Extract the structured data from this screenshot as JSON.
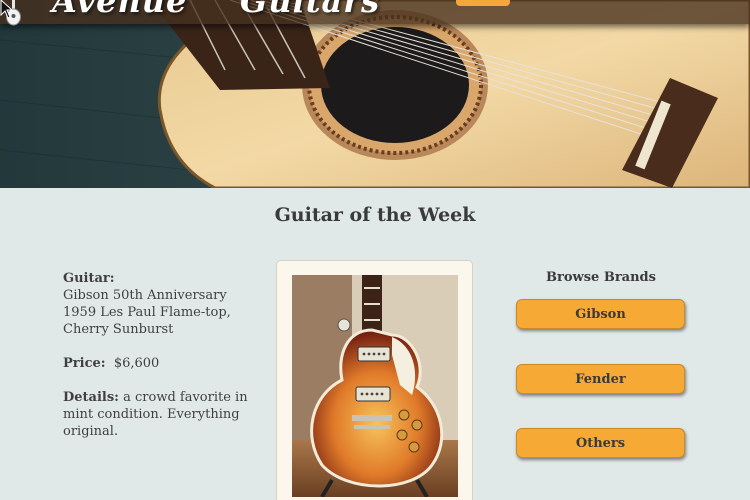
{
  "header": {
    "logo_word_1": "Avenue",
    "logo_word_2": "Guitars",
    "logo_icon": "guitar-icon"
  },
  "section_title": "Guitar of the Week",
  "featured": {
    "guitar_label": "Guitar:",
    "guitar_value": "Gibson 50th Anniversary 1959 Les Paul Flame-top, Cherry Sunburst",
    "price_label": "Price:",
    "price_value": "$6,600",
    "details_label": "Details:",
    "details_value": "a crowd favorite in mint condition. Everything original."
  },
  "brands": {
    "title": "Browse Brands",
    "items": [
      {
        "label": "Gibson"
      },
      {
        "label": "Fender"
      },
      {
        "label": "Others"
      }
    ]
  },
  "colors": {
    "accent": "#f7a935",
    "background": "#e1e9e8",
    "header_bar": "#46301e"
  }
}
